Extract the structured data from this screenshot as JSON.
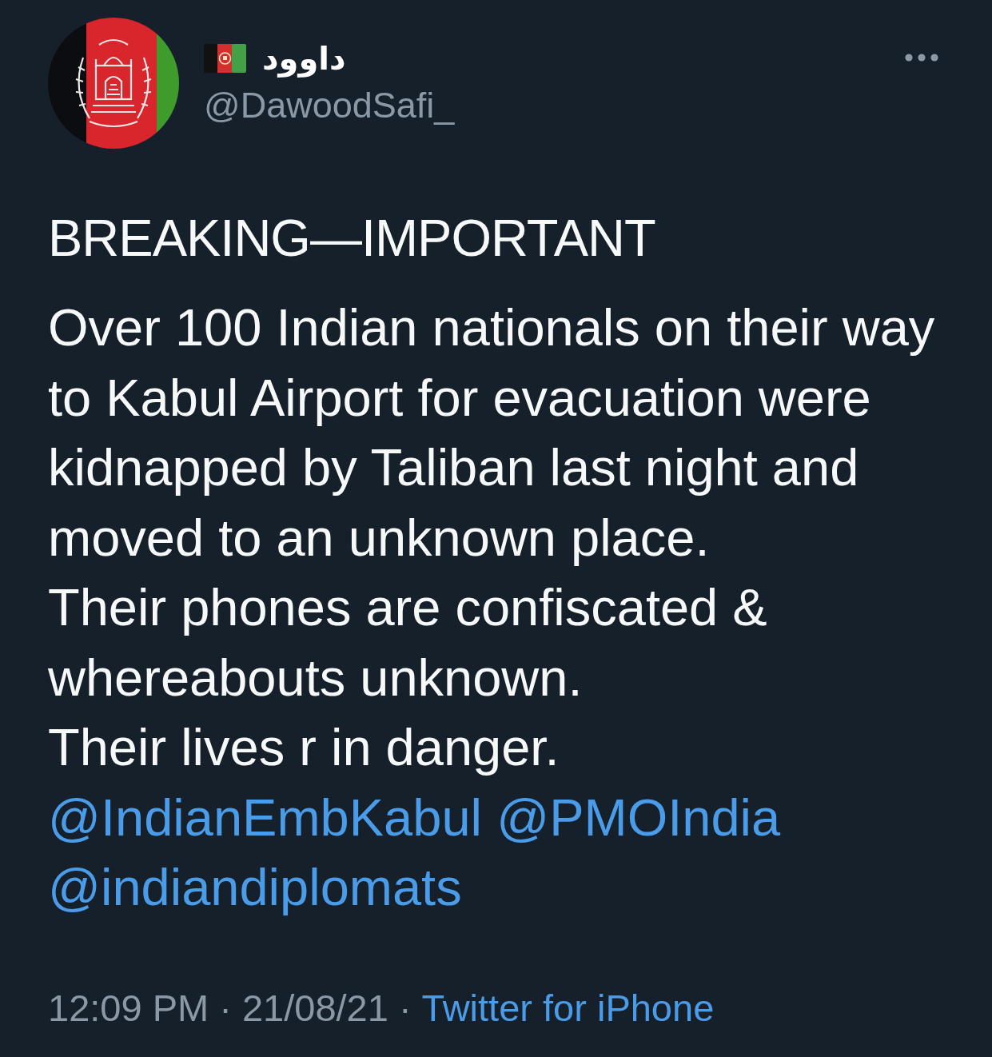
{
  "author": {
    "name": "داوود",
    "handle": "@DawoodSafi_"
  },
  "tweet": {
    "headline": "BREAKING—IMPORTANT",
    "lines": [
      "Over 100 Indian nationals on their way to Kabul Airport for evacuation were kidnapped by Taliban last night and moved to an unknown place.",
      "Their phones are confiscated & whereabouts unknown.",
      "Their lives r in danger."
    ],
    "mentions": [
      "@IndianEmbKabul",
      "@PMOIndia",
      "@indiandiplomats"
    ]
  },
  "meta": {
    "posted": "12:09 PM · 21/08/21",
    "separator": "·",
    "source": "Twitter for iPhone"
  }
}
